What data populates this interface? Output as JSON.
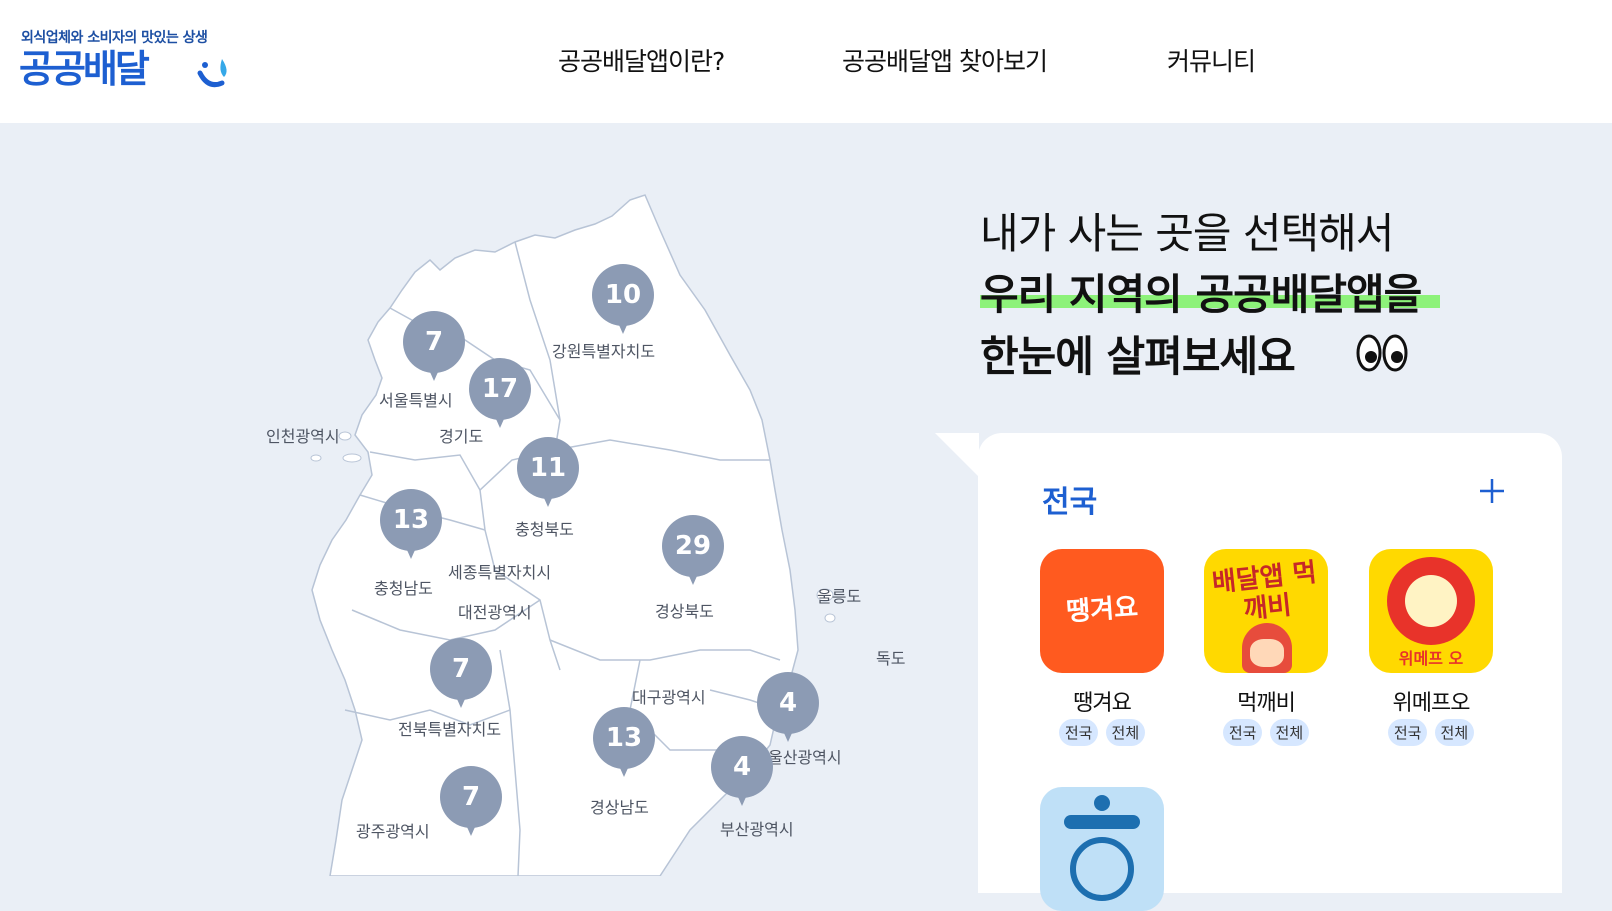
{
  "brand": {
    "tagline": "외식업체와 소비자의 맛있는 상생",
    "name": "공공배달"
  },
  "nav": {
    "items": [
      "공공배달앱이란?",
      "공공배달앱 찾아보기",
      "커뮤니티"
    ]
  },
  "headline": {
    "line1": "내가 사는 곳을 선택해서",
    "line2": "우리 지역의 공공배달앱을",
    "line3": "한눈에 살펴보세요"
  },
  "map": {
    "regions": [
      {
        "name": "강원특별자치도",
        "count": "10"
      },
      {
        "name": "서울특별시",
        "count": "7"
      },
      {
        "name": "경기도",
        "count": "17"
      },
      {
        "name": "인천광역시",
        "count": ""
      },
      {
        "name": "충청북도",
        "count": "11"
      },
      {
        "name": "충청남도",
        "count": "13"
      },
      {
        "name": "세종특별자치시",
        "count": ""
      },
      {
        "name": "대전광역시",
        "count": ""
      },
      {
        "name": "경상북도",
        "count": "29"
      },
      {
        "name": "울릉도",
        "count": ""
      },
      {
        "name": "독도",
        "count": ""
      },
      {
        "name": "전북특별자치도",
        "count": "7"
      },
      {
        "name": "대구광역시",
        "count": ""
      },
      {
        "name": "울산광역시",
        "count": "4"
      },
      {
        "name": "경상남도",
        "count": "13"
      },
      {
        "name": "부산광역시",
        "count": "4"
      },
      {
        "name": "광주광역시",
        "count": "7"
      }
    ]
  },
  "panel": {
    "title": "전국",
    "apps": [
      {
        "name": "땡겨요",
        "tags": [
          "전국",
          "전체"
        ],
        "icon_text": "땡겨요",
        "bg": "#ff5a1f"
      },
      {
        "name": "먹깨비",
        "tags": [
          "전국",
          "전체"
        ],
        "icon_text": "배달앱 먹깨비",
        "bg": "#ffd900"
      },
      {
        "name": "위메프오",
        "tags": [
          "전국",
          "전체"
        ],
        "icon_text": "위메프 오",
        "bg": "#ffd900"
      },
      {
        "name": "",
        "tags": [],
        "icon_text": "",
        "bg": "#bfe0f7"
      }
    ]
  },
  "colors": {
    "brand_blue": "#1d5fd1",
    "pin": "#8c9bb4",
    "highlight": "#8df27a",
    "page_bg": "#eaeff6"
  }
}
